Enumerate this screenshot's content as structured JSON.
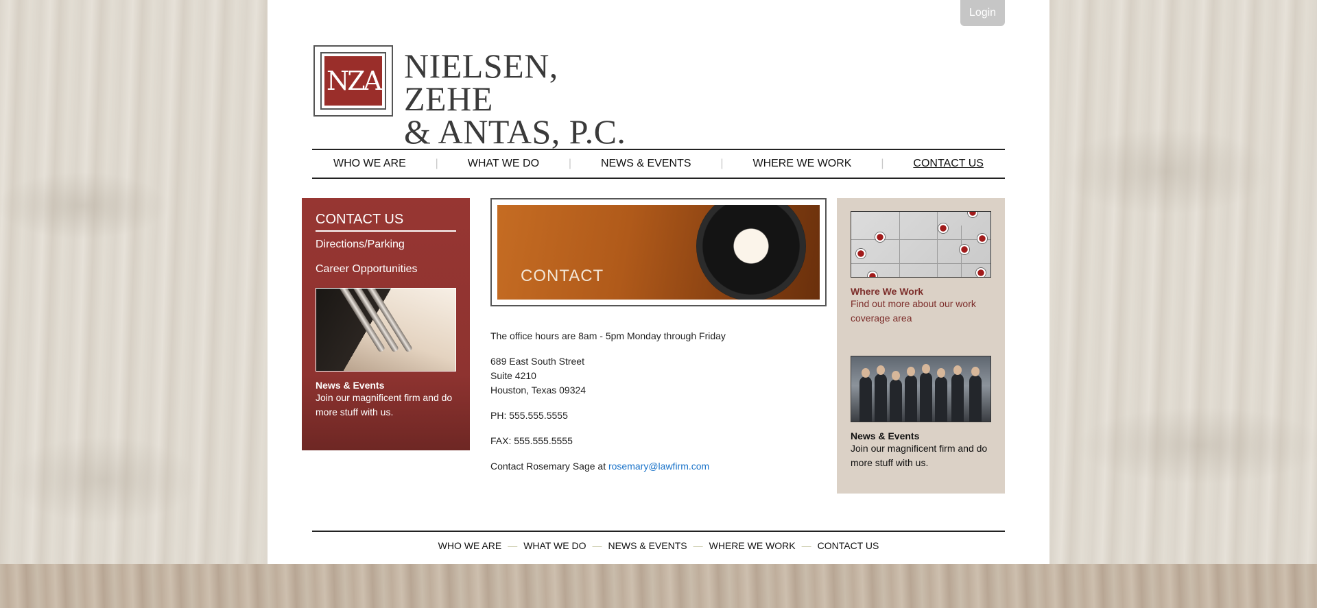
{
  "header": {
    "login_label": "Login",
    "logo_mark": "NZA",
    "logo_line1": "NIELSEN, ZEHE",
    "logo_line2": "& ANTAS, P.C."
  },
  "nav": {
    "items": [
      {
        "label": "WHO WE ARE"
      },
      {
        "label": "WHAT WE DO"
      },
      {
        "label": "NEWS & EVENTS"
      },
      {
        "label": "WHERE WE WORK"
      },
      {
        "label": "CONTACT US",
        "active": true
      }
    ],
    "separator": "|"
  },
  "left_sidebar": {
    "title": "CONTACT US",
    "links": [
      {
        "label": "Directions/Parking"
      },
      {
        "label": "Career Opportunities"
      }
    ],
    "news_title": "News & Events",
    "news_body": "Join our magnificent firm and do more stuff with us."
  },
  "banner": {
    "text": "CONTACT"
  },
  "contact_info": {
    "hours": "The office hours are 8am - 5pm Monday through Friday",
    "address_line1": "689 East South Street",
    "address_line2": "Suite 4210",
    "address_line3": "Houston, Texas 09324",
    "phone": "PH: 555.555.5555",
    "fax": "FAX: 555.555.5555",
    "contact_prefix": "Contact Rosemary Sage at",
    "email": "rosemary@lawfirm.com"
  },
  "right_sidebar": {
    "where_title": "Where We Work",
    "where_body": "Find out more about our work coverage area",
    "news_title": "News & Events",
    "news_body": "Join our magnificent firm and do more stuff with us."
  },
  "footer": {
    "links": [
      {
        "label": "WHO WE ARE"
      },
      {
        "label": "WHAT WE DO"
      },
      {
        "label": "NEWS & EVENTS"
      },
      {
        "label": "WHERE WE WORK"
      },
      {
        "label": "CONTACT US"
      }
    ],
    "separator": "—"
  },
  "colors": {
    "brand_red": "#973632",
    "link_blue": "#1a73c9",
    "sidebar_beige": "#dbd1c6"
  }
}
